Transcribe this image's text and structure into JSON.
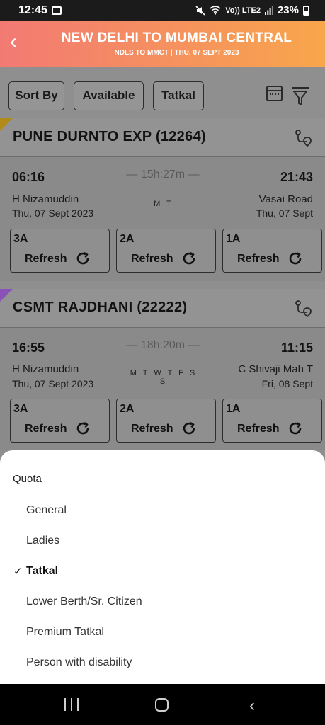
{
  "status": {
    "time": "12:45",
    "network_label": "Vo)) LTE2",
    "battery": "23%"
  },
  "header": {
    "title": "NEW DELHI TO MUMBAI CENTRAL",
    "subtitle": "NDLS TO MMCT | THU, 07 SEPT 2023",
    "gradient_start": "#f27a73",
    "gradient_end": "#f8a64c"
  },
  "filters": {
    "sort_label": "Sort By",
    "available_label": "Available",
    "tatkal_label": "Tatkal"
  },
  "trains": [
    {
      "name": "PUNE DURNTO EXP (12264)",
      "dep_time": "06:16",
      "arr_time": "21:43",
      "duration": "15h:27m",
      "from": "H Nizamuddin",
      "to": "Vasai Road",
      "dep_date": "Thu, 07 Sept  2023",
      "arr_date": "Thu, 07 Sept",
      "days": "M   T",
      "classes": [
        {
          "name": "3A",
          "action": "Refresh"
        },
        {
          "name": "2A",
          "action": "Refresh"
        },
        {
          "name": "1A",
          "action": "Refresh"
        }
      ]
    },
    {
      "name": "CSMT RAJDHANI (22222)",
      "dep_time": "16:55",
      "arr_time": "11:15",
      "duration": "18h:20m",
      "from": "H Nizamuddin",
      "to": "C Shivaji Mah T",
      "dep_date": "Thu, 07 Sept  2023",
      "arr_date": "Fri, 08 Sept",
      "days": "M T W T F S S",
      "classes": [
        {
          "name": "3A",
          "action": "Refresh"
        },
        {
          "name": "2A",
          "action": "Refresh"
        },
        {
          "name": "1A",
          "action": "Refresh"
        }
      ]
    }
  ],
  "quota": {
    "title": "Quota",
    "selected": "Tatkal",
    "check_mark": "✓",
    "options": [
      "General",
      "Ladies",
      "Tatkal",
      "Lower Berth/Sr. Citizen",
      "Premium Tatkal",
      "Person with disability"
    ]
  },
  "icons": [
    "image-icon",
    "mute-icon",
    "wifi-icon",
    "signal-icon",
    "battery-icon",
    "back-arrow-icon",
    "calendar-icon",
    "filter-icon",
    "route-icon",
    "refresh-icon",
    "recent-apps-icon",
    "home-icon",
    "nav-back-icon"
  ]
}
